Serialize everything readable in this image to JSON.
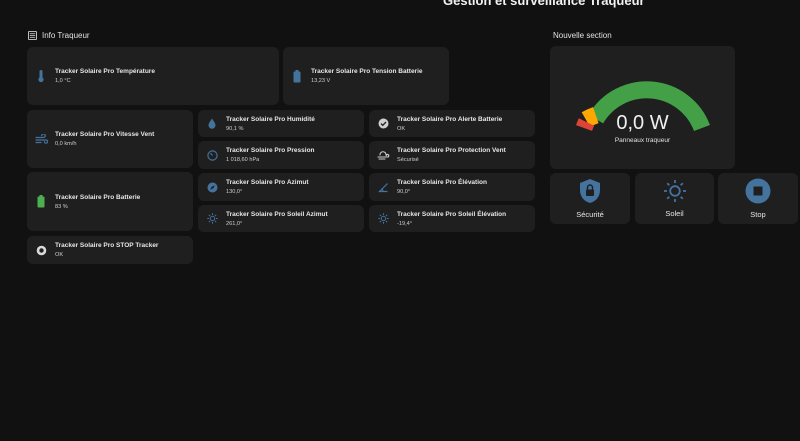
{
  "page": {
    "title": "Gestion et surveillance Traqueur"
  },
  "info_section": {
    "title": "Info Traqueur",
    "icon": "list-icon"
  },
  "nouvelle_section": {
    "title": "Nouvelle section"
  },
  "cards": {
    "temperature": {
      "name": "Tracker Solaire Pro Température",
      "value": "1,0 °C",
      "icon": "thermometer-icon"
    },
    "tension": {
      "name": "Tracker Solaire Pro Tension Batterie",
      "value": "13,23 V",
      "icon": "battery-icon"
    },
    "vent": {
      "name": "Tracker Solaire Pro Vitesse Vent",
      "value": "0,0 km/h",
      "icon": "wind-icon"
    },
    "batterie": {
      "name": "Tracker Solaire Pro Batterie",
      "value": "83 %",
      "icon": "battery-green-icon"
    },
    "stop": {
      "name": "Tracker Solaire Pro STOP Tracker",
      "value": "OK",
      "icon": "radio-icon"
    },
    "humidite": {
      "name": "Tracker Solaire Pro Humidité",
      "value": "90,1 %",
      "icon": "water-drop-icon"
    },
    "pression": {
      "name": "Tracker Solaire Pro Pression",
      "value": "1 018,60 hPa",
      "icon": "gauge-icon"
    },
    "azimut": {
      "name": "Tracker Solaire Pro Azimut",
      "value": "130,0°",
      "icon": "compass-icon"
    },
    "soleil_azimut": {
      "name": "Tracker Solaire Pro Soleil Azimut",
      "value": "261,0°",
      "icon": "sun-icon"
    },
    "alerte": {
      "name": "Tracker Solaire Pro Alerte Batterie",
      "value": "OK",
      "icon": "check-circle-icon"
    },
    "protection": {
      "name": "Tracker Solaire Pro Protection Vent",
      "value": "Sécurisé",
      "icon": "weather-windy-icon"
    },
    "elevation": {
      "name": "Tracker Solaire Pro Élévation",
      "value": "90,0°",
      "icon": "angle-icon"
    },
    "soleil_elevation": {
      "name": "Tracker Solaire Pro Soleil Élévation",
      "value": "-19,4°",
      "icon": "sun-icon"
    }
  },
  "gauge": {
    "value": "0,0 W",
    "label": "Panneaux traqueur",
    "level": 0,
    "colors": {
      "red": "#db4437",
      "yellow": "#ffa600",
      "green": "#43a047"
    }
  },
  "buttons": {
    "securite": {
      "label": "Sécurité",
      "icon": "shield-lock-icon"
    },
    "soleil": {
      "label": "Soleil",
      "icon": "sun-icon"
    },
    "stop": {
      "label": "Stop",
      "icon": "stop-circle-icon"
    }
  },
  "colors": {
    "icon": "#44739e",
    "battery_green": "#4caf50",
    "background": "#111111",
    "card": "#1f1f1f"
  }
}
